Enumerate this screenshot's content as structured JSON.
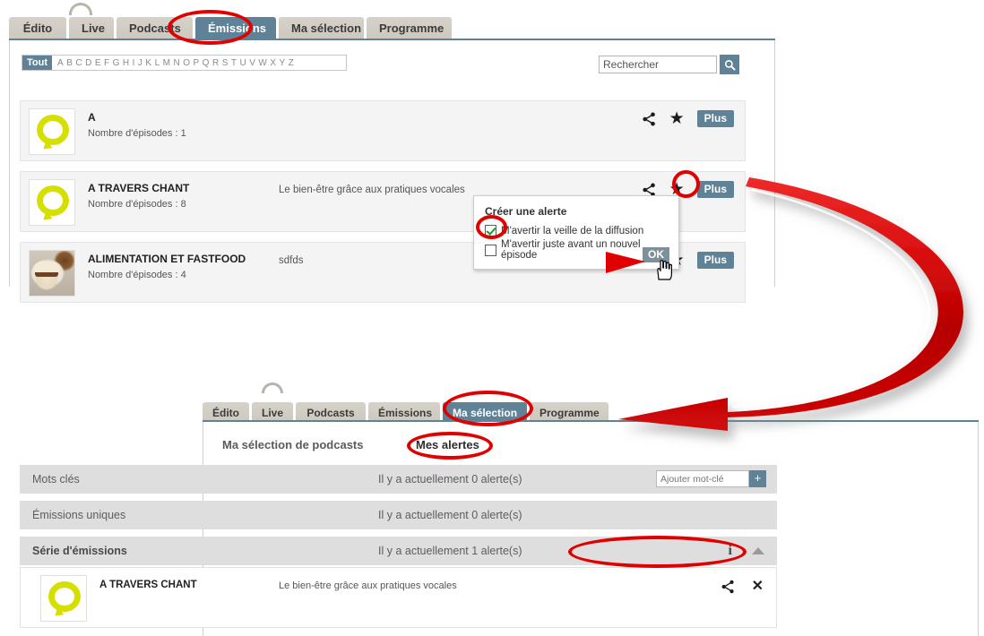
{
  "top_panel": {
    "tabs": [
      {
        "label": "Édito",
        "active": false
      },
      {
        "label": "Live",
        "active": false
      },
      {
        "label": "Podcasts",
        "active": false
      },
      {
        "label": "Émissions",
        "active": true
      },
      {
        "label": "Ma sélection",
        "active": false
      },
      {
        "label": "Programme",
        "active": false
      }
    ],
    "filter": {
      "all_label": "Tout",
      "letters": [
        "A",
        "B",
        "C",
        "D",
        "E",
        "F",
        "G",
        "H",
        "I",
        "J",
        "K",
        "L",
        "M",
        "N",
        "O",
        "P",
        "Q",
        "R",
        "S",
        "T",
        "U",
        "V",
        "W",
        "X",
        "Y",
        "Z"
      ]
    },
    "search": {
      "value": "Rechercher",
      "placeholder": "Rechercher",
      "icon": "search-icon"
    },
    "rows": [
      {
        "title": "A",
        "episodes": "Nombre d'épisodes : 1",
        "description": "",
        "thumb": "bubble",
        "share_icon": "share-icon",
        "star_icon": "star-icon",
        "more_label": "Plus"
      },
      {
        "title": "A TRAVERS CHANT",
        "episodes": "Nombre d'épisodes : 8",
        "description": "Le bien-être grâce aux pratiques vocales",
        "thumb": "bubble",
        "share_icon": "share-icon",
        "star_icon": "star-icon",
        "more_label": "Plus"
      },
      {
        "title": "ALIMENTATION ET FASTFOOD",
        "episodes": "Nombre d'épisodes : 4",
        "description": "sdfds",
        "thumb": "food",
        "share_icon": "share-icon",
        "star_icon": "star-icon",
        "more_label": "Plus"
      }
    ],
    "alert_popup": {
      "title": "Créer une alerte",
      "options": [
        {
          "label": "M'avertir la veille de la diffusion",
          "checked": true
        },
        {
          "label": "M'avertir juste avant un nouvel épisode",
          "checked": false
        }
      ],
      "ok_label": "OK"
    }
  },
  "bottom_panel": {
    "tabs": [
      {
        "label": "Édito",
        "active": false
      },
      {
        "label": "Live",
        "active": false
      },
      {
        "label": "Podcasts",
        "active": false
      },
      {
        "label": "Émissions",
        "active": false
      },
      {
        "label": "Ma sélection",
        "active": true
      },
      {
        "label": "Programme",
        "active": false
      }
    ],
    "headings": {
      "selection": "Ma sélection de podcasts",
      "alerts": "Mes alertes"
    },
    "sections": [
      {
        "label": "Mots clés",
        "count_text": "Il y a actuellement 0 alerte(s)",
        "keyword_input": {
          "placeholder": "Ajouter mot-clé",
          "value": ""
        },
        "add_label": "+"
      },
      {
        "label": "Émissions uniques",
        "count_text": "Il y a actuellement 0 alerte(s)"
      },
      {
        "label": "Série d'émissions",
        "count_text": "Il y a actuellement 1 alerte(s)",
        "info_icon": "info-icon",
        "collapse_icon": "caret-up-icon"
      }
    ],
    "alert_items": [
      {
        "title": "A TRAVERS CHANT",
        "description": "Le bien-être grâce aux pratiques vocales",
        "share_icon": "share-icon",
        "remove_icon": "close-icon"
      }
    ]
  },
  "annotations": {
    "accent_color": "#e00000",
    "arrow_color": "#cc0000",
    "highlight_targets": [
      "tab-emissions",
      "star-icon-row-2",
      "checkbox-veille",
      "tab-ma-selection",
      "mes-alertes-heading",
      "serie-emissions-count"
    ]
  }
}
